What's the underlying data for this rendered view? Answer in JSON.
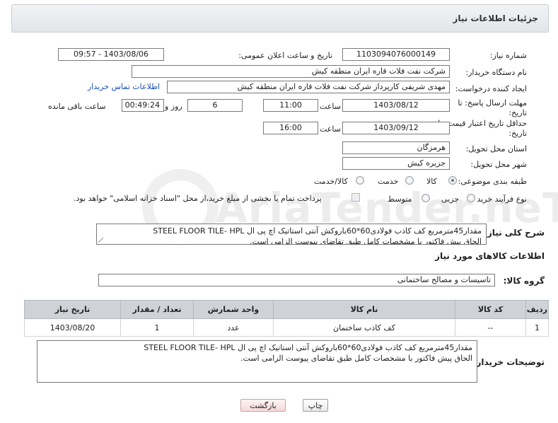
{
  "header": {
    "title": "جزئیات اطلاعات نیاز"
  },
  "form": {
    "need_number": {
      "label": "شماره نیاز:",
      "value": "1103094076000149"
    },
    "announce_datetime": {
      "label": "تاریخ و ساعت اعلان عمومی:",
      "value": "1403/08/06 - 09:57"
    },
    "buyer_org": {
      "label": "نام دستگاه خریدار:",
      "value": "شرکت نفت فلات قاره ایران منطقه کیش"
    },
    "requester": {
      "label": "ایجاد کننده درخواست:",
      "value": "مهدی شریفی کارپرداز شرکت نفت فلات قاره ایران منطقه کیش",
      "contact_link": "اطلاعات تماس خریدار"
    },
    "reply_deadline": {
      "label_line1": "مهلت ارسال پاسخ: تا",
      "label_line2": "تاریخ:",
      "date": "1403/08/12",
      "time_label": "ساعت",
      "time": "11:00",
      "days": "6",
      "days_label": "روز و",
      "remaining": "00:49:24",
      "remaining_label": "ساعت باقی مانده"
    },
    "price_validity": {
      "label_line1": "حداقل تاریخ اعتبار قیمت: تا",
      "label_line2": "تاریخ:",
      "date": "1403/09/12",
      "time_label": "ساعت",
      "time": "16:00"
    },
    "province": {
      "label": "استان محل تحویل:",
      "value": "هرمزگان"
    },
    "city": {
      "label": "شهر محل تحویل:",
      "value": "جزیره کیش"
    },
    "category": {
      "label": "طبقه بندی موضوعی:",
      "options": [
        "کالا",
        "خدمت",
        "کالا/خدمت"
      ],
      "selected": "کالا"
    },
    "purchase_type": {
      "label": "نوع فرآیند خرید :",
      "options": [
        "جزیی",
        "متوسط"
      ],
      "payment_note": "پرداخت تمام یا بخشی از مبلغ خرید،از محل \"اسناد خزانه اسلامی\" خواهد بود."
    },
    "general_description": {
      "label": "شرح کلی نیاز:",
      "line1": "مقدار45مترمربع کف کاذب فولادی60*60باروکش آنتی استاتیک اچ پی ال STEEL FLOOR TILE- HPL",
      "line2": "الحاق پیش فاکتور با مشخصات کامل طبق تقاضای پیوست الزامی است."
    }
  },
  "goods_section": {
    "title": "اطلاعات کالاهای مورد نیاز",
    "group_label": "گروه کالا:",
    "group_value": "تاسیسات و مصالح ساختمانی",
    "table": {
      "headers": [
        "ردیف",
        "کد کالا",
        "نام کالا",
        "واحد شمارش",
        "تعداد / مقدار",
        "تاریخ نیاز"
      ],
      "rows": [
        [
          "1",
          "--",
          "کف کاذب ساختمان",
          "عدد",
          "1",
          "1403/08/20"
        ]
      ]
    }
  },
  "buyer_notes": {
    "label": "توضیحات خریدار:",
    "line1": "مقدار45مترمربع کف کاذب فولادی60*60باروکش آنتی استاتیک اچ پی ال STEEL FLOOR TILE- HPL",
    "line2": "الحاق پیش فاکتور با مشخصات کامل طبق تقاضای پیوست الزامی است."
  },
  "buttons": {
    "print": "چاپ",
    "back": "بازگشت"
  },
  "watermark": {
    "text": "AriaTender.neT"
  }
}
